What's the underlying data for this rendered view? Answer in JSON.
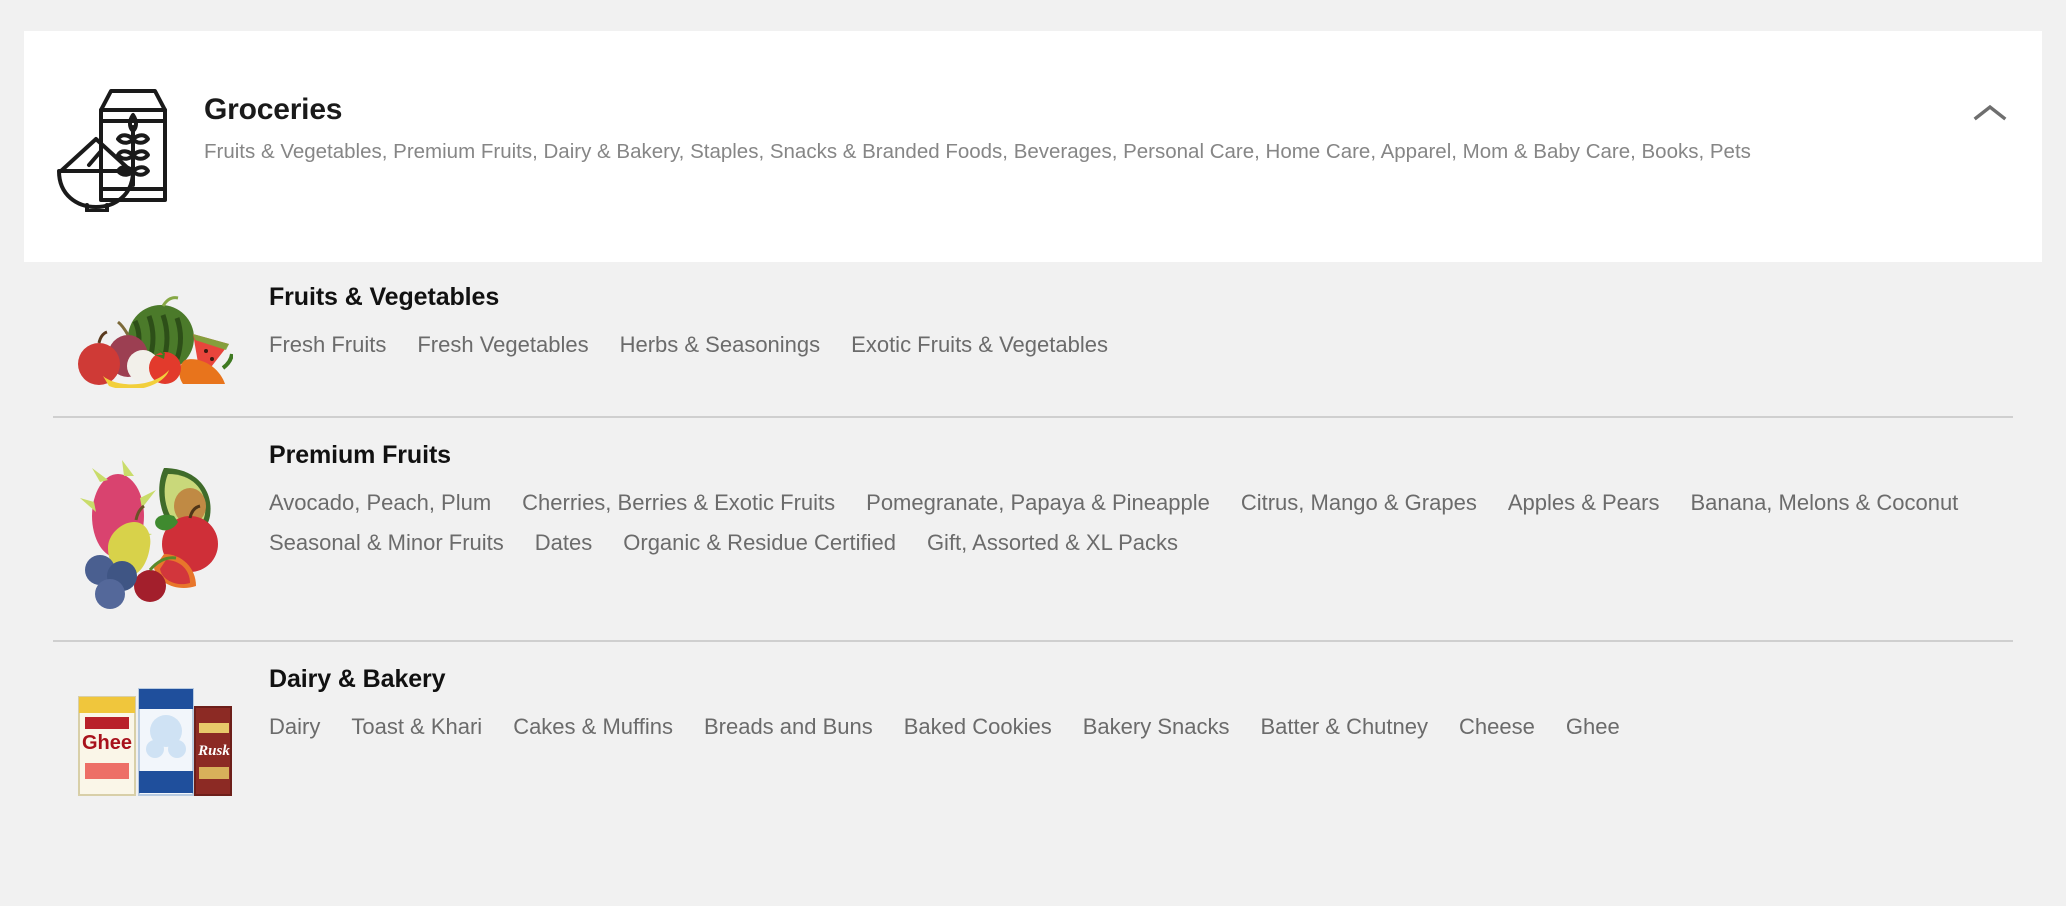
{
  "category_card": {
    "icon": "groceries-bowl-packet-icon",
    "title": "Groceries",
    "subtitle": "Fruits & Vegetables, Premium Fruits, Dairy & Bakery, Staples, Snacks & Branded Foods, Beverages, Personal Care, Home Care, Apparel, Mom & Baby Care, Books, Pets",
    "toggle_icon": "chevron-up-icon"
  },
  "colors": {
    "page_background": "#f1f1f1",
    "card_background": "#ffffff",
    "title_text": "#111111",
    "subtitle_text": "#868686",
    "link_text": "#6b6b6b",
    "divider": "#cfcfcf"
  },
  "sections": [
    {
      "id": "fruits-vegetables",
      "thumb": "fruits-vegetables-photo",
      "title": "Fruits & Vegetables",
      "links": [
        "Fresh Fruits",
        "Fresh Vegetables",
        "Herbs & Seasonings",
        "Exotic Fruits & Vegetables"
      ]
    },
    {
      "id": "premium-fruits",
      "thumb": "premium-fruits-photo",
      "title": "Premium Fruits",
      "links": [
        "Avocado, Peach, Plum",
        "Cherries, Berries & Exotic Fruits",
        "Pomegranate, Papaya & Pineapple",
        "Citrus, Mango & Grapes",
        "Apples & Pears",
        "Banana, Melons & Coconut",
        "Seasonal & Minor Fruits",
        "Dates",
        "Organic & Residue Certified",
        "Gift, Assorted & XL Packs"
      ]
    },
    {
      "id": "dairy-bakery",
      "thumb": "dairy-bakery-photo",
      "title": "Dairy & Bakery",
      "links": [
        "Dairy",
        "Toast & Khari",
        "Cakes & Muffins",
        "Breads and Buns",
        "Baked Cookies",
        "Bakery Snacks",
        "Batter & Chutney",
        "Cheese",
        "Ghee"
      ]
    }
  ]
}
